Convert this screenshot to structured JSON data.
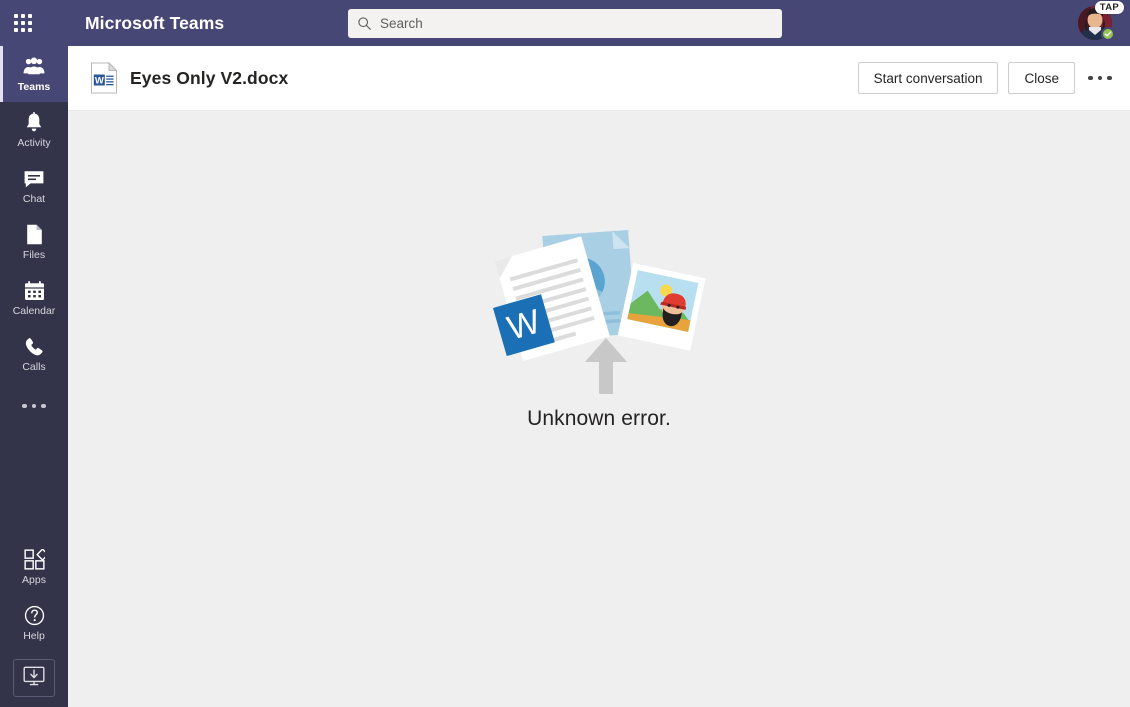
{
  "app": {
    "name": "Microsoft Teams",
    "accent_color": "#464775",
    "rail_color": "#33344a",
    "canvas_color": "#f0eff0"
  },
  "topbar": {
    "waffle_icon": "app-launcher-grid-icon",
    "brand": "Microsoft Teams",
    "search": {
      "placeholder": "Search",
      "value": "",
      "icon": "search-icon"
    },
    "profile": {
      "badge_label": "TAP",
      "presence": "Available",
      "presence_color": "#92c353",
      "avatar_icon": "user-avatar"
    }
  },
  "sidebar": {
    "items": [
      {
        "label": "Teams",
        "icon": "teams-icon",
        "active": true
      },
      {
        "label": "Activity",
        "icon": "bell-icon",
        "active": false
      },
      {
        "label": "Chat",
        "icon": "chat-bubble-icon",
        "active": false
      },
      {
        "label": "Files",
        "icon": "file-icon",
        "active": false
      },
      {
        "label": "Calendar",
        "icon": "calendar-icon",
        "active": false
      },
      {
        "label": "Calls",
        "icon": "phone-icon",
        "active": false
      }
    ],
    "more_icon": "ellipsis-icon",
    "bottom_items": [
      {
        "label": "Apps",
        "icon": "apps-icon"
      },
      {
        "label": "Help",
        "icon": "help-circle-icon"
      }
    ],
    "download_button": {
      "label": "",
      "icon": "download-desktop-app-icon"
    }
  },
  "document_header": {
    "file_icon": "word-document-icon",
    "title": "Eyes Only V2.docx",
    "start_conversation_label": "Start conversation",
    "close_label": "Close",
    "more_icon": "ellipsis-icon"
  },
  "content": {
    "illustration": "file-upload-illustration",
    "message": "Unknown error."
  }
}
